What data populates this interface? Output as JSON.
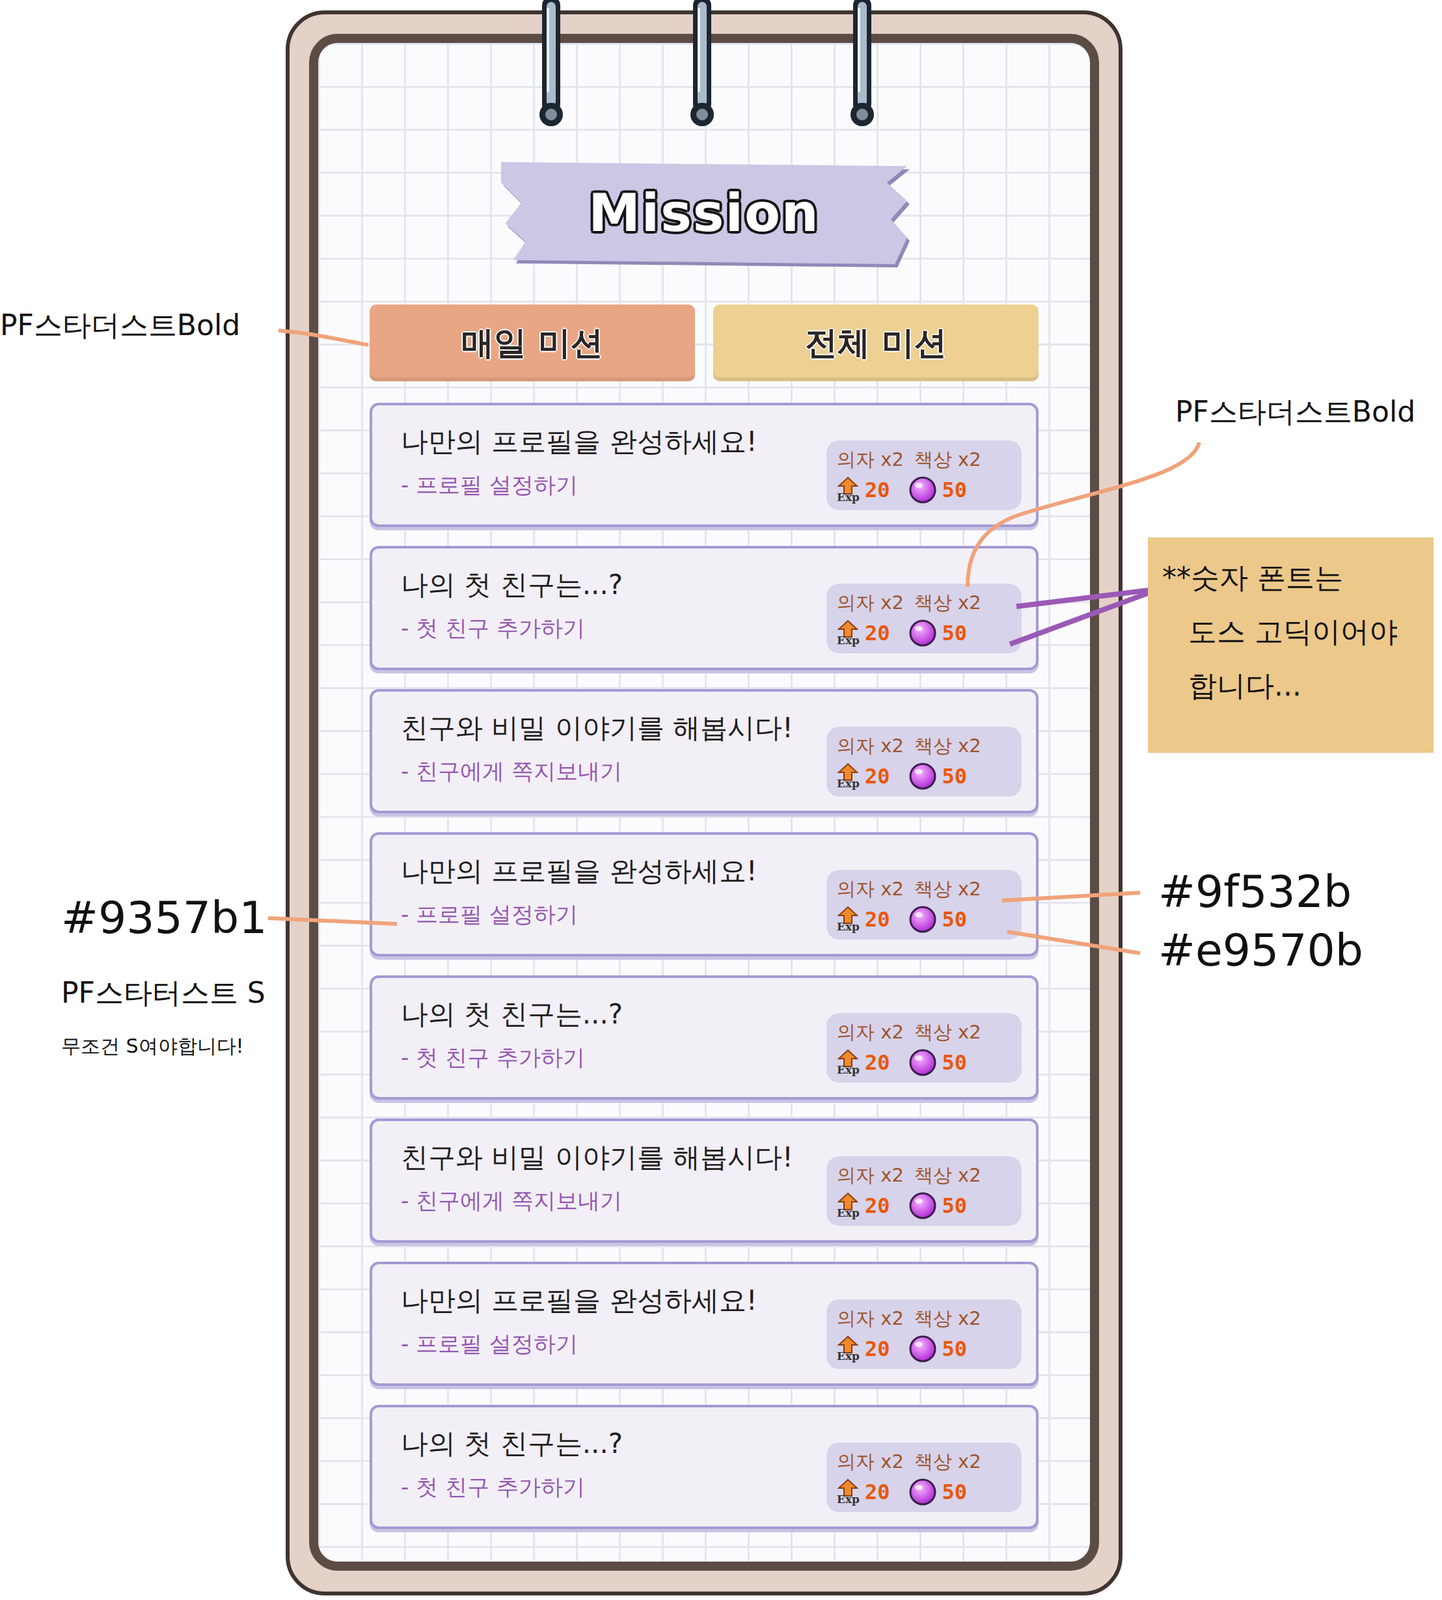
{
  "title": "Mission",
  "tabs": [
    {
      "label": "매일 미션",
      "selected": true
    },
    {
      "label": "전체 미션",
      "selected": false
    }
  ],
  "missions": [
    {
      "title": "나만의 프로필을 완성하세요!",
      "task": "- 프로필 설정하기",
      "items": [
        "의자 x2",
        "책상 x2"
      ],
      "exp_label": "Exp",
      "exp": "20",
      "gems": "50"
    },
    {
      "title": "나의 첫 친구는...?",
      "task": "- 첫 친구 추가하기",
      "items": [
        "의자 x2",
        "책상 x2"
      ],
      "exp_label": "Exp",
      "exp": "20",
      "gems": "50"
    },
    {
      "title": "친구와 비밀 이야기를 해봅시다!",
      "task": "- 친구에게 쪽지보내기",
      "items": [
        "의자 x2",
        "책상 x2"
      ],
      "exp_label": "Exp",
      "exp": "20",
      "gems": "50"
    },
    {
      "title": "나만의 프로필을 완성하세요!",
      "task": "- 프로필 설정하기",
      "items": [
        "의자 x2",
        "책상 x2"
      ],
      "exp_label": "Exp",
      "exp": "20",
      "gems": "50"
    },
    {
      "title": "나의 첫 친구는...?",
      "task": "- 첫 친구 추가하기",
      "items": [
        "의자 x2",
        "책상 x2"
      ],
      "exp_label": "Exp",
      "exp": "20",
      "gems": "50"
    },
    {
      "title": "친구와 비밀 이야기를 해봅시다!",
      "task": "- 친구에게 쪽지보내기",
      "items": [
        "의자 x2",
        "책상 x2"
      ],
      "exp_label": "Exp",
      "exp": "20",
      "gems": "50"
    },
    {
      "title": "나만의 프로필을 완성하세요!",
      "task": "- 프로필 설정하기",
      "items": [
        "의자 x2",
        "책상 x2"
      ],
      "exp_label": "Exp",
      "exp": "20",
      "gems": "50"
    },
    {
      "title": "나의 첫 친구는...?",
      "task": "- 첫 친구 추가하기",
      "items": [
        "의자 x2",
        "책상 x2"
      ],
      "exp_label": "Exp",
      "exp": "20",
      "gems": "50"
    }
  ],
  "annotations": {
    "tab_font": "PF스타더스트Bold",
    "reward_font": "PF스타더스트Bold",
    "number_font_note": [
      "**숫자 폰트는",
      "도스 고딕이어야",
      "합니다..."
    ],
    "task_color": "#9357b1",
    "task_font": "PF스타터스트 S",
    "task_font_note": "무조건 S여야합니다!",
    "item_color": "#9f532b",
    "number_color": "#e9570b"
  }
}
